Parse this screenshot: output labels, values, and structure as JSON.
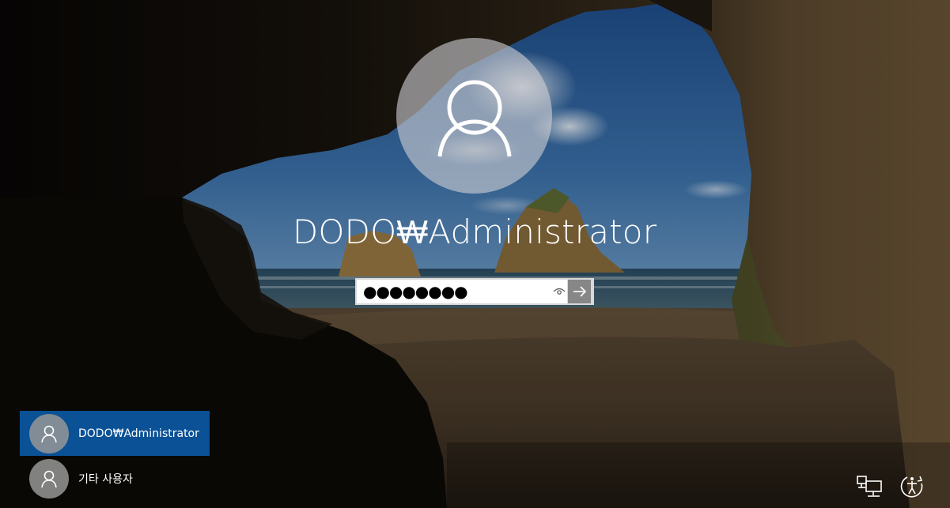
{
  "login": {
    "account_name": "DODO₩Administrator",
    "password_masked": "●●●●●●●●",
    "password_field_type": "password"
  },
  "user_list": [
    {
      "name": "DODO₩Administrator",
      "selected": true
    },
    {
      "name": "기타 사용자",
      "selected": false
    }
  ],
  "icons": {
    "large_avatar": "user-icon",
    "reveal": "eye-icon",
    "submit": "arrow-right-icon",
    "network": "network-icon",
    "ease_of_access": "ease-of-access-icon"
  },
  "colors": {
    "selected_user_bg": "#0a5196",
    "text": "#ffffff",
    "input_bg": "#ffffff"
  }
}
